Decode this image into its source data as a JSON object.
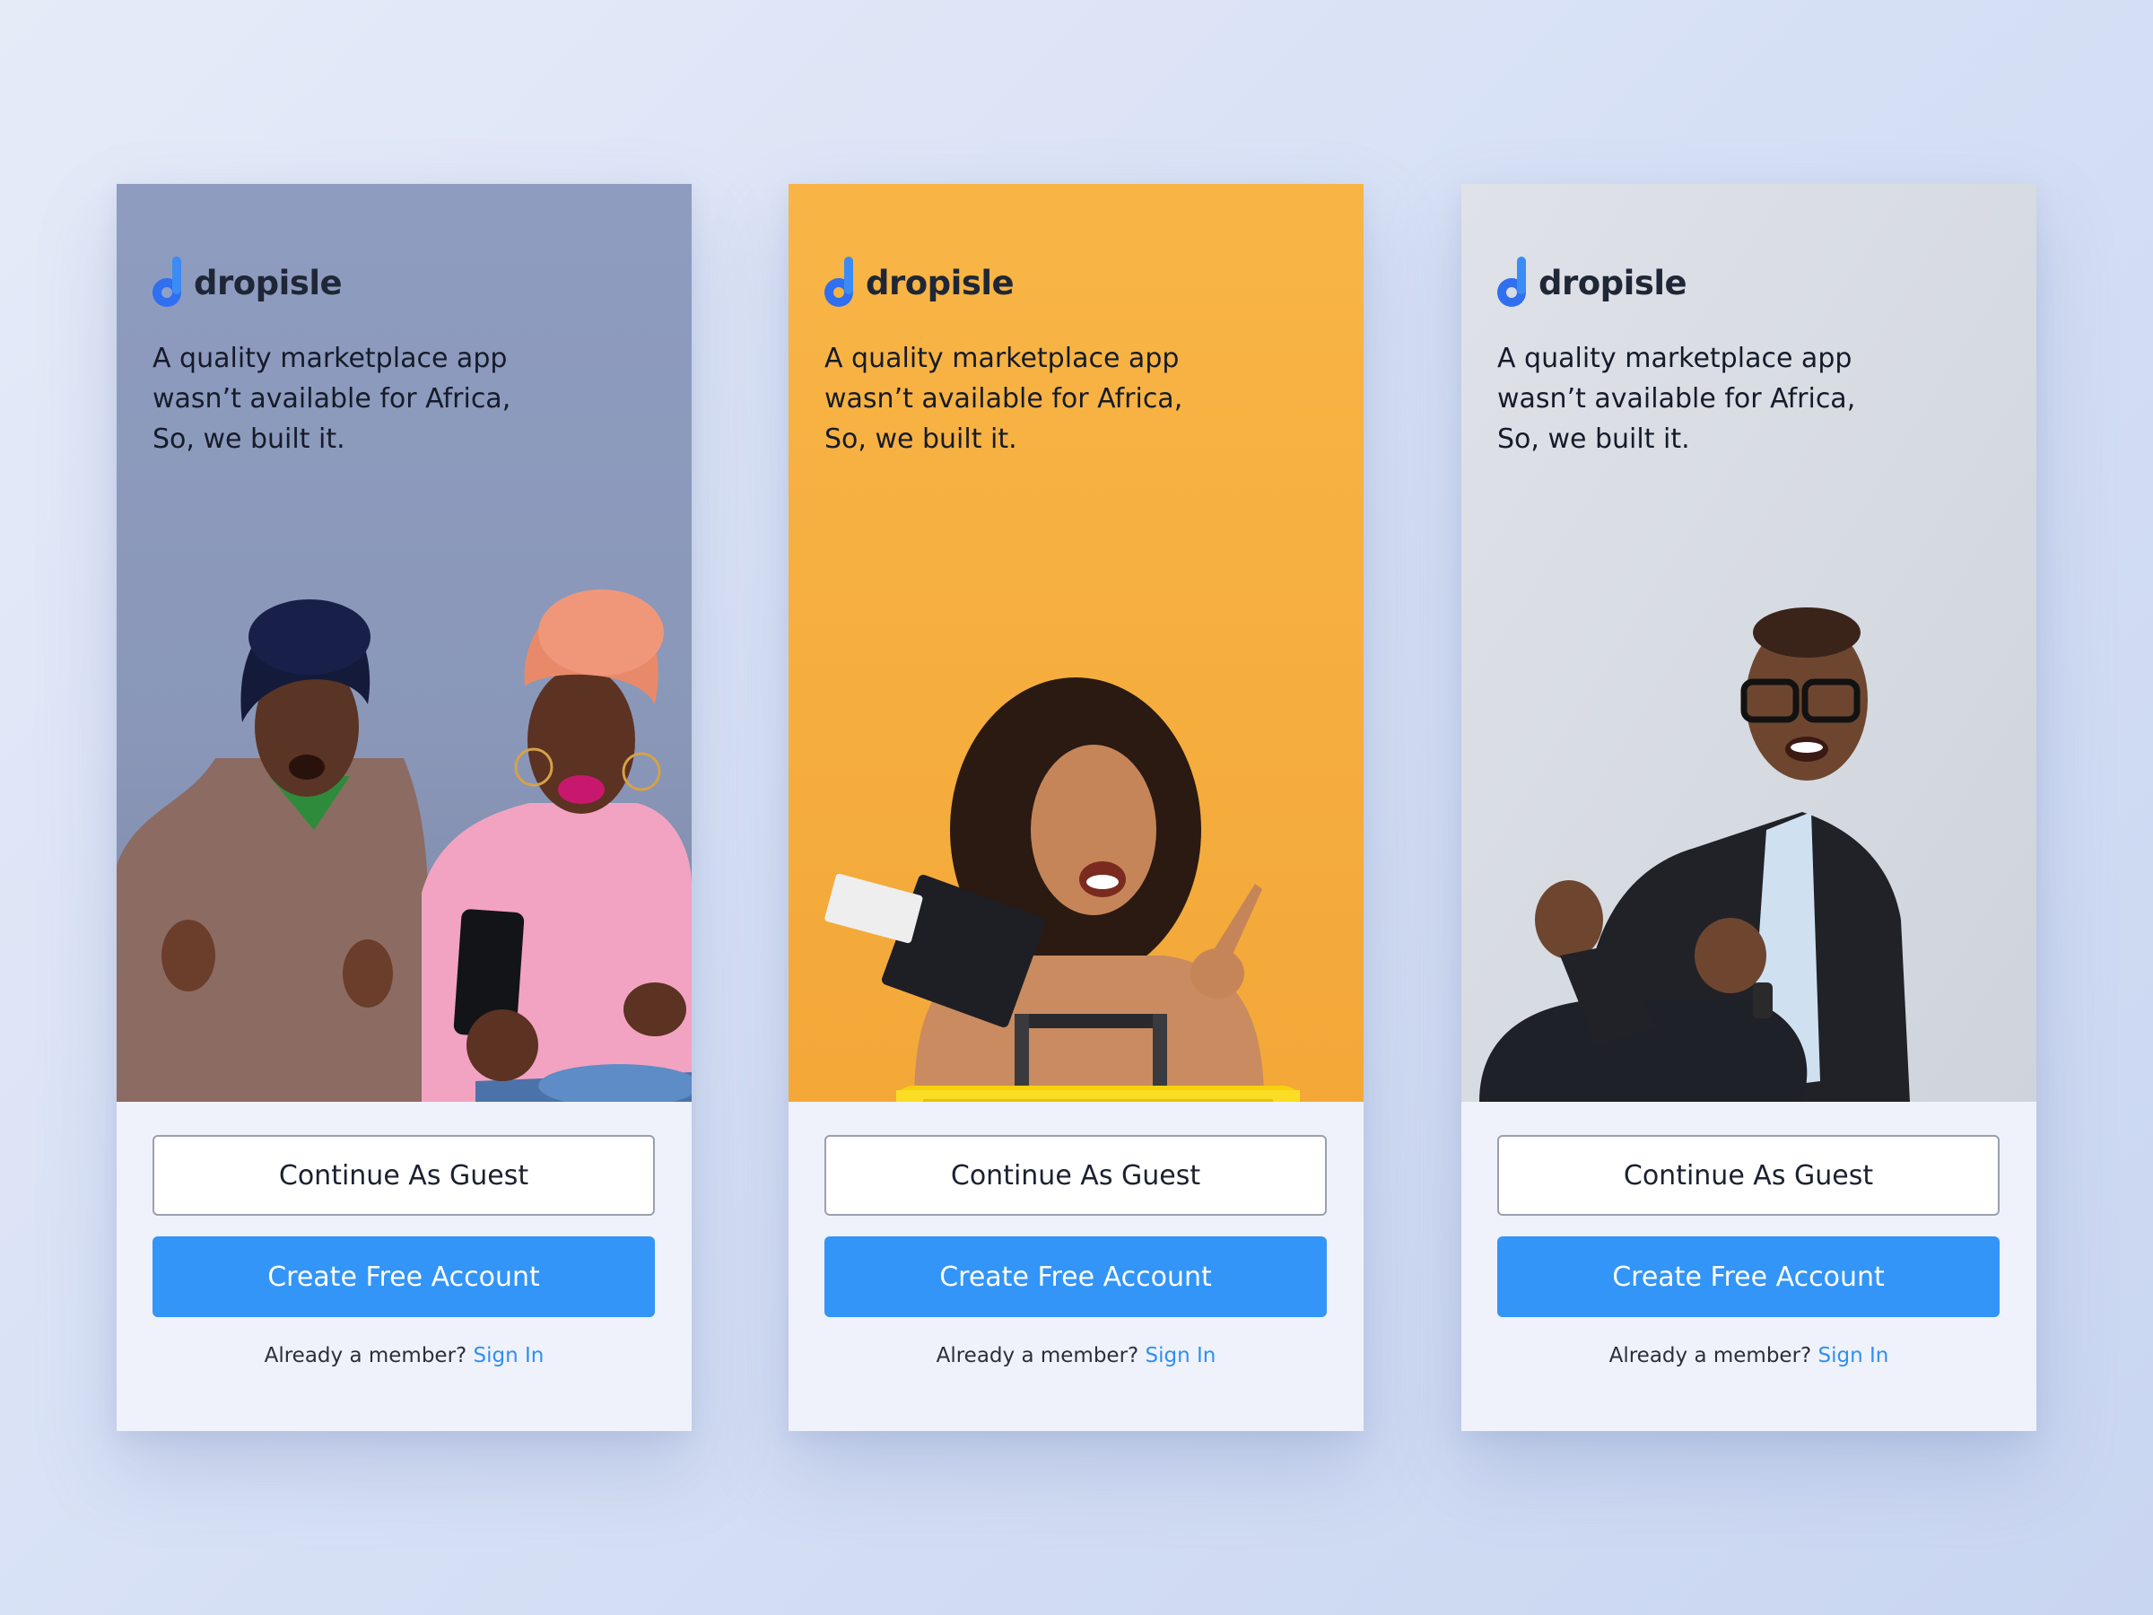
{
  "screens": [
    {
      "logo_text": "dropisle",
      "tagline": [
        "A quality marketplace app",
        "wasn’t available for Africa,",
        "So, we built it."
      ],
      "guest_label": "Continue As Guest",
      "create_label": "Create Free Account",
      "member_text": "Already a member?",
      "signin_label": "Sign In",
      "hero_bg": "#8f9dbf"
    },
    {
      "logo_text": "dropisle",
      "tagline": [
        "A quality marketplace app",
        "wasn’t available for Africa,",
        "So, we built it."
      ],
      "guest_label": "Continue As Guest",
      "create_label": "Create Free Account",
      "member_text": "Already a member?",
      "signin_label": "Sign In",
      "hero_bg": "#f7b23f"
    },
    {
      "logo_text": "dropisle",
      "tagline": [
        "A quality marketplace app",
        "wasn’t available for Africa,",
        "So, we built it."
      ],
      "guest_label": "Continue As Guest",
      "create_label": "Create Free Account",
      "member_text": "Already a member?",
      "signin_label": "Sign In",
      "hero_bg": "#d7dbe3"
    }
  ],
  "colors": {
    "brand_blue": "#3395f7",
    "link_blue": "#2f8ff2",
    "logo_blue": "#2f6ff0",
    "page_bg": "#dbe3f6",
    "panel_bg": "#eff2fb"
  },
  "icons": [
    "dropisle-logo-icon"
  ]
}
